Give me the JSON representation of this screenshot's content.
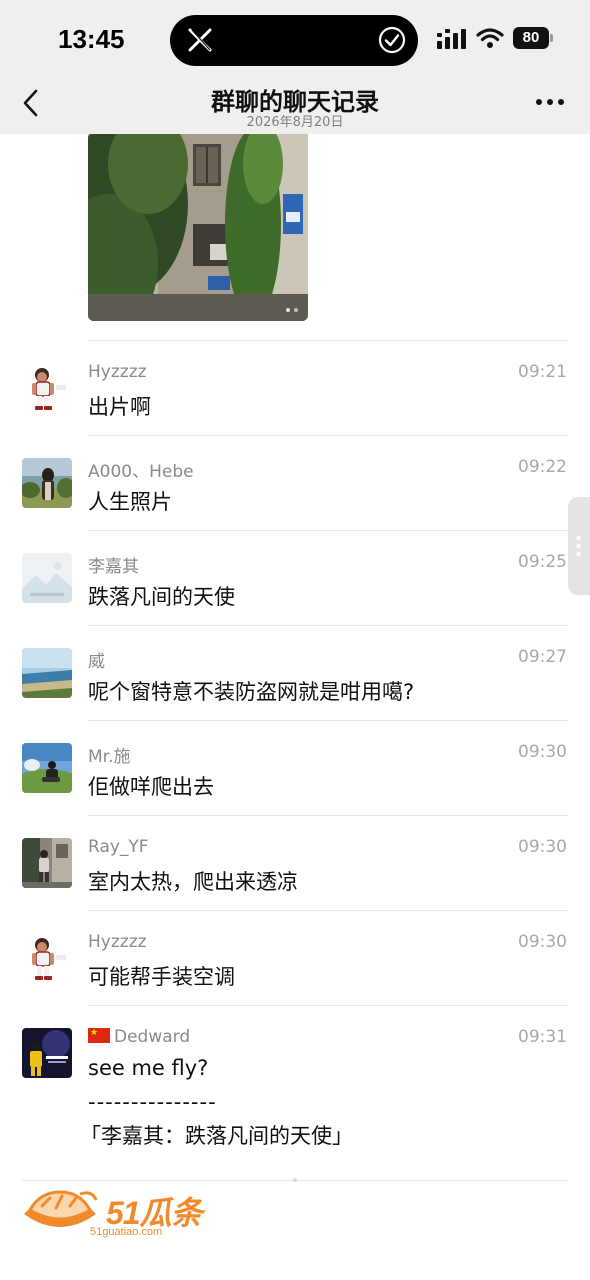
{
  "status_bar": {
    "time": "13:45",
    "battery": "80",
    "icons": [
      "x-logo-icon",
      "check-circle-icon",
      "signal-icon",
      "wifi-icon",
      "battery-icon"
    ]
  },
  "header": {
    "title": "群聊的聊天记录",
    "date": "2026年8月20日",
    "back_icon": "chevron-left-icon",
    "more_icon": "more-dots-icon"
  },
  "messages": [
    {
      "sender": "Hyzzzz",
      "time": "09:21",
      "text": "出片啊",
      "avatar": "cartoon-player"
    },
    {
      "sender": "A000、Hebe",
      "time": "09:22",
      "text": "人生照片",
      "avatar": "girl-landscape"
    },
    {
      "sender": "李嘉其",
      "time": "09:25",
      "text": "跌落凡间的天使",
      "avatar": "placeholder-image"
    },
    {
      "sender": "威",
      "time": "09:27",
      "text": "呢个窗特意不装防盗网就是咁用噶?",
      "avatar": "sea-coast"
    },
    {
      "sender": "Mr.施",
      "time": "09:30",
      "text": "佢做咩爬出去",
      "avatar": "person-grass"
    },
    {
      "sender": "Ray_YF",
      "time": "09:30",
      "text": "室内太热，爬出来透凉",
      "avatar": "street-person"
    },
    {
      "sender": "Hyzzzz",
      "time": "09:30",
      "text": "可能帮手装空调",
      "avatar": "cartoon-player"
    },
    {
      "sender": "Dedward",
      "time": "09:31",
      "text": "see me fly?",
      "separator": "---------------",
      "quote": "「李嘉其：跌落凡间的天使」",
      "avatar": "forever-poster",
      "flag": "china-flag-icon"
    }
  ],
  "watermark": {
    "text": "51瓜条",
    "url": "51guatiao.com"
  },
  "colors": {
    "bar_bg": "#efefef",
    "accent": "#f08a2b",
    "muted": "#8a8a8a"
  }
}
